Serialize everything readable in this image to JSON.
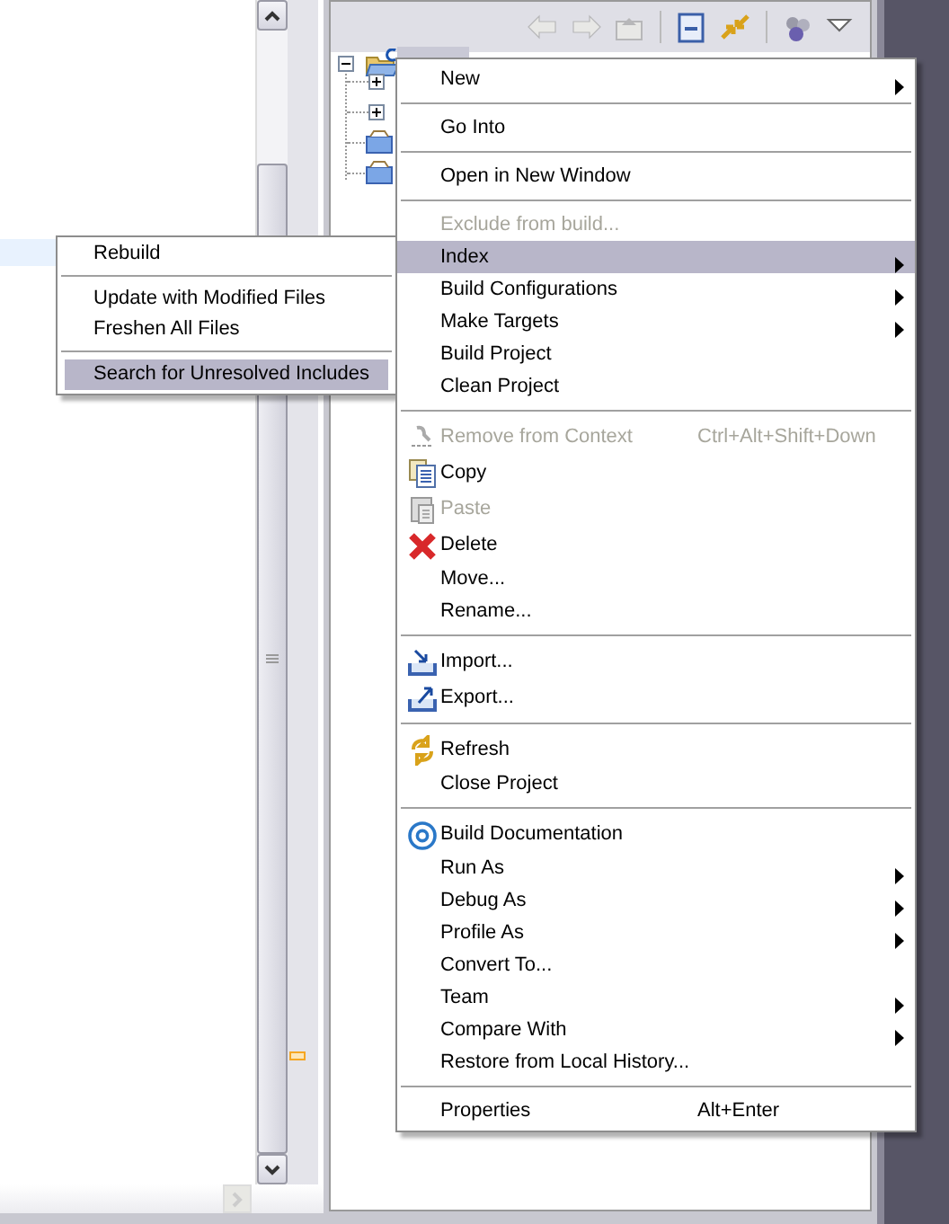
{
  "toolbar": {
    "buttons": [
      {
        "disabled": true
      },
      {
        "disabled": true
      },
      {
        "disabled": true
      },
      {
        "disabled": false
      },
      {
        "disabled": false
      },
      {
        "disabled": false
      },
      {
        "disabled": false
      }
    ]
  },
  "tree": {
    "expanded": true,
    "selected": true,
    "children": [
      {
        "kind": "expandable",
        "expanded": false
      },
      {
        "kind": "expandable",
        "expanded": false
      },
      {
        "kind": "folder"
      },
      {
        "kind": "folder"
      }
    ]
  },
  "context_menu": {
    "items": [
      {
        "kind": "item",
        "label": "New",
        "disabled": false,
        "selected": false,
        "submenu": true
      },
      {
        "kind": "separator"
      },
      {
        "kind": "item",
        "label": "Go Into",
        "disabled": false,
        "selected": false,
        "submenu": false
      },
      {
        "kind": "separator"
      },
      {
        "kind": "item",
        "label": "Open in New Window",
        "disabled": false,
        "selected": false,
        "submenu": false
      },
      {
        "kind": "separator"
      },
      {
        "kind": "item",
        "label": "Exclude from build...",
        "disabled": true,
        "selected": false,
        "submenu": false
      },
      {
        "kind": "item",
        "label": "Index",
        "disabled": false,
        "selected": true,
        "submenu": true
      },
      {
        "kind": "item",
        "label": "Build Configurations",
        "disabled": false,
        "selected": false,
        "submenu": true
      },
      {
        "kind": "item",
        "label": "Make Targets",
        "disabled": false,
        "selected": false,
        "submenu": true
      },
      {
        "kind": "item",
        "label": "Build Project",
        "disabled": false,
        "selected": false,
        "submenu": false
      },
      {
        "kind": "item",
        "label": "Clean Project",
        "disabled": false,
        "selected": false,
        "submenu": false
      },
      {
        "kind": "separator"
      },
      {
        "kind": "item",
        "label": "Remove from Context",
        "shortcut": "Ctrl+Alt+Shift+Down",
        "disabled": true,
        "selected": false,
        "submenu": false
      },
      {
        "kind": "item",
        "label": "Copy",
        "disabled": false,
        "selected": false,
        "submenu": false
      },
      {
        "kind": "item",
        "label": "Paste",
        "disabled": true,
        "selected": false,
        "submenu": false
      },
      {
        "kind": "item",
        "label": "Delete",
        "disabled": false,
        "selected": false,
        "submenu": false
      },
      {
        "kind": "item",
        "label": "Move...",
        "disabled": false,
        "selected": false,
        "submenu": false
      },
      {
        "kind": "item",
        "label": "Rename...",
        "disabled": false,
        "selected": false,
        "submenu": false
      },
      {
        "kind": "separator"
      },
      {
        "kind": "item",
        "label": "Import...",
        "disabled": false,
        "selected": false,
        "submenu": false
      },
      {
        "kind": "item",
        "label": "Export...",
        "disabled": false,
        "selected": false,
        "submenu": false
      },
      {
        "kind": "separator"
      },
      {
        "kind": "item",
        "label": "Refresh",
        "disabled": false,
        "selected": false,
        "submenu": false
      },
      {
        "kind": "item",
        "label": "Close Project",
        "disabled": false,
        "selected": false,
        "submenu": false
      },
      {
        "kind": "separator"
      },
      {
        "kind": "item",
        "label": "Build Documentation",
        "disabled": false,
        "selected": false,
        "submenu": false
      },
      {
        "kind": "item",
        "label": "Run As",
        "disabled": false,
        "selected": false,
        "submenu": true
      },
      {
        "kind": "item",
        "label": "Debug As",
        "disabled": false,
        "selected": false,
        "submenu": true
      },
      {
        "kind": "item",
        "label": "Profile As",
        "disabled": false,
        "selected": false,
        "submenu": true
      },
      {
        "kind": "item",
        "label": "Convert To...",
        "disabled": false,
        "selected": false,
        "submenu": false
      },
      {
        "kind": "item",
        "label": "Team",
        "disabled": false,
        "selected": false,
        "submenu": true
      },
      {
        "kind": "item",
        "label": "Compare With",
        "disabled": false,
        "selected": false,
        "submenu": true
      },
      {
        "kind": "item",
        "label": "Restore from Local History...",
        "disabled": false,
        "selected": false,
        "submenu": false
      },
      {
        "kind": "separator"
      },
      {
        "kind": "item",
        "label": "Properties",
        "shortcut": "Alt+Enter",
        "disabled": false,
        "selected": false,
        "submenu": false
      }
    ]
  },
  "index_submenu": {
    "items": [
      {
        "kind": "item",
        "label": "Rebuild",
        "selected": false
      },
      {
        "kind": "separator"
      },
      {
        "kind": "item",
        "label": "Update with Modified Files",
        "selected": false
      },
      {
        "kind": "item",
        "label": "Freshen All Files",
        "selected": false
      },
      {
        "kind": "separator"
      },
      {
        "kind": "item",
        "label": "Search for Unresolved Includes",
        "selected": true
      }
    ]
  }
}
